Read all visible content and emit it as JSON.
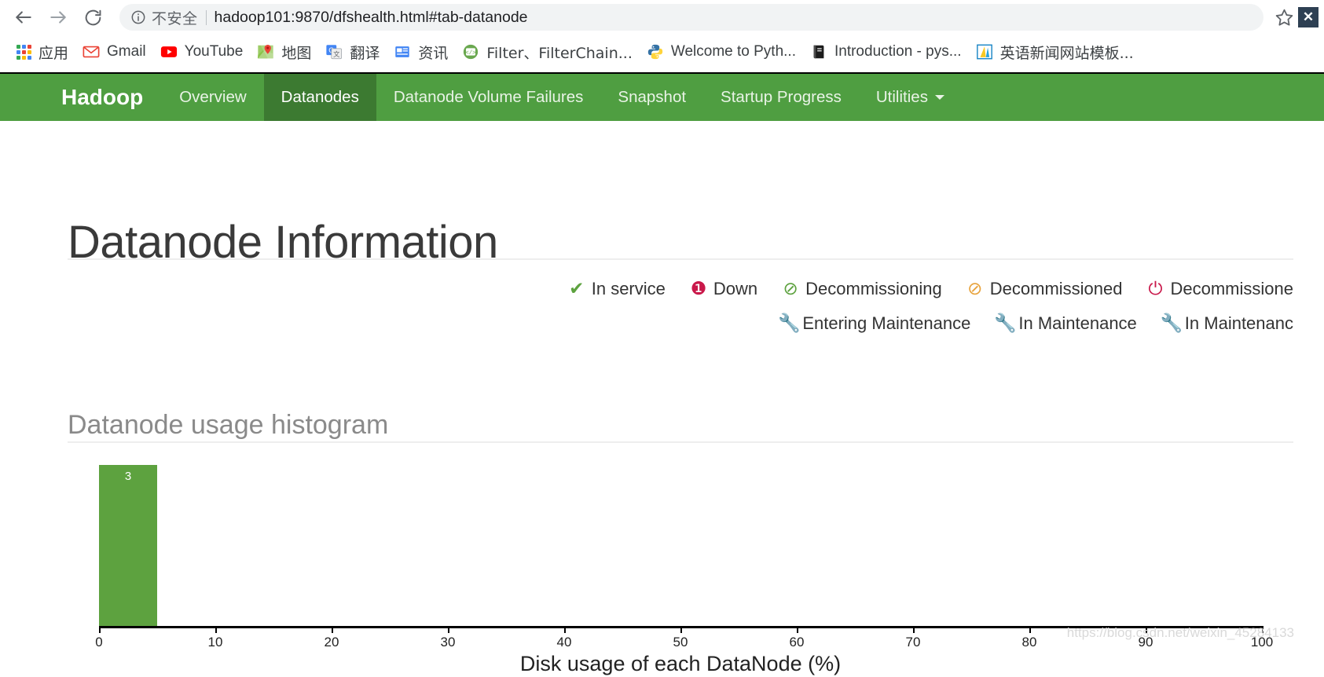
{
  "browser": {
    "back_icon": "back-arrow-icon",
    "forward_icon": "forward-arrow-icon",
    "reload_icon": "reload-icon",
    "info_icon": "info-circle-icon",
    "security_label": "不安全",
    "url": "hadoop101:9870/dfshealth.html#tab-datanode",
    "star_icon": "star-icon",
    "close_label": "✕",
    "bookmarks": [
      {
        "label": "应用",
        "icon": "apps-grid-icon",
        "latin": false
      },
      {
        "label": "Gmail",
        "icon": "gmail-icon",
        "latin": true
      },
      {
        "label": "YouTube",
        "icon": "youtube-icon",
        "latin": true
      },
      {
        "label": "地图",
        "icon": "google-maps-icon",
        "latin": false
      },
      {
        "label": "翻译",
        "icon": "google-translate-icon",
        "latin": false
      },
      {
        "label": "资讯",
        "icon": "google-news-icon",
        "latin": false
      },
      {
        "label": "Filter、FilterChain...",
        "icon": "code-page-icon",
        "latin": false
      },
      {
        "label": "Welcome to Pyth...",
        "icon": "python-icon",
        "latin": true
      },
      {
        "label": "Introduction - pys...",
        "icon": "book-icon",
        "latin": true
      },
      {
        "label": "英语新闻网站模板...",
        "icon": "template-icon",
        "latin": false
      }
    ]
  },
  "hadoop_nav": {
    "brand": "Hadoop",
    "accent_color": "#4f9e41",
    "active_color": "#3c7a31",
    "items": [
      {
        "label": "Overview",
        "active": false,
        "caret": false
      },
      {
        "label": "Datanodes",
        "active": true,
        "caret": false
      },
      {
        "label": "Datanode Volume Failures",
        "active": false,
        "caret": false
      },
      {
        "label": "Snapshot",
        "active": false,
        "caret": false
      },
      {
        "label": "Startup Progress",
        "active": false,
        "caret": false
      },
      {
        "label": "Utilities",
        "active": false,
        "caret": true
      }
    ]
  },
  "page": {
    "title": "Datanode Information",
    "histogram_title": "Datanode usage histogram",
    "watermark": "https://blog.csdn.net/weixin_45284133"
  },
  "legend": {
    "row1": [
      {
        "label": "In service",
        "glyph": "✔",
        "color": "#5da23f",
        "icon": "check-icon"
      },
      {
        "label": "Down",
        "glyph": "❶",
        "color": "#c9184a",
        "icon": "exclamation-circle-icon"
      },
      {
        "label": "Decommissioning",
        "glyph": "⊘",
        "color": "#5da23f",
        "icon": "ban-circle-icon"
      },
      {
        "label": "Decommissioned",
        "glyph": "⊘",
        "color": "#e8a33d",
        "icon": "ban-circle-icon"
      },
      {
        "label": "Decommissione",
        "glyph": "⏻",
        "color": "#c9184a",
        "icon": "power-off-icon"
      }
    ],
    "row2": [
      {
        "label": "Entering Maintenance",
        "glyph": "🔧",
        "color": "#5da23f",
        "icon": "wrench-icon"
      },
      {
        "label": "In Maintenance",
        "glyph": "🔧",
        "color": "#e8a33d",
        "icon": "wrench-icon"
      },
      {
        "label": "In Maintenanc",
        "glyph": "🔧",
        "color": "#c9184a",
        "icon": "wrench-icon"
      }
    ]
  },
  "chart_data": {
    "type": "bar",
    "title": "Datanode usage histogram",
    "xlabel": "Disk usage of each DataNode (%)",
    "ylabel": "",
    "xlim": [
      0,
      100
    ],
    "ylim": [
      0,
      3
    ],
    "grid": false,
    "legend_position": "none",
    "bar_color": "#5da23f",
    "tick_labels": [
      "0",
      "10",
      "20",
      "30",
      "40",
      "50",
      "60",
      "70",
      "80",
      "90",
      "100"
    ],
    "ticks": [
      0,
      10,
      20,
      30,
      40,
      50,
      60,
      70,
      80,
      90,
      100
    ],
    "bars": [
      {
        "x_start": 0,
        "x_end": 5,
        "value": 3,
        "label": "3"
      }
    ]
  }
}
